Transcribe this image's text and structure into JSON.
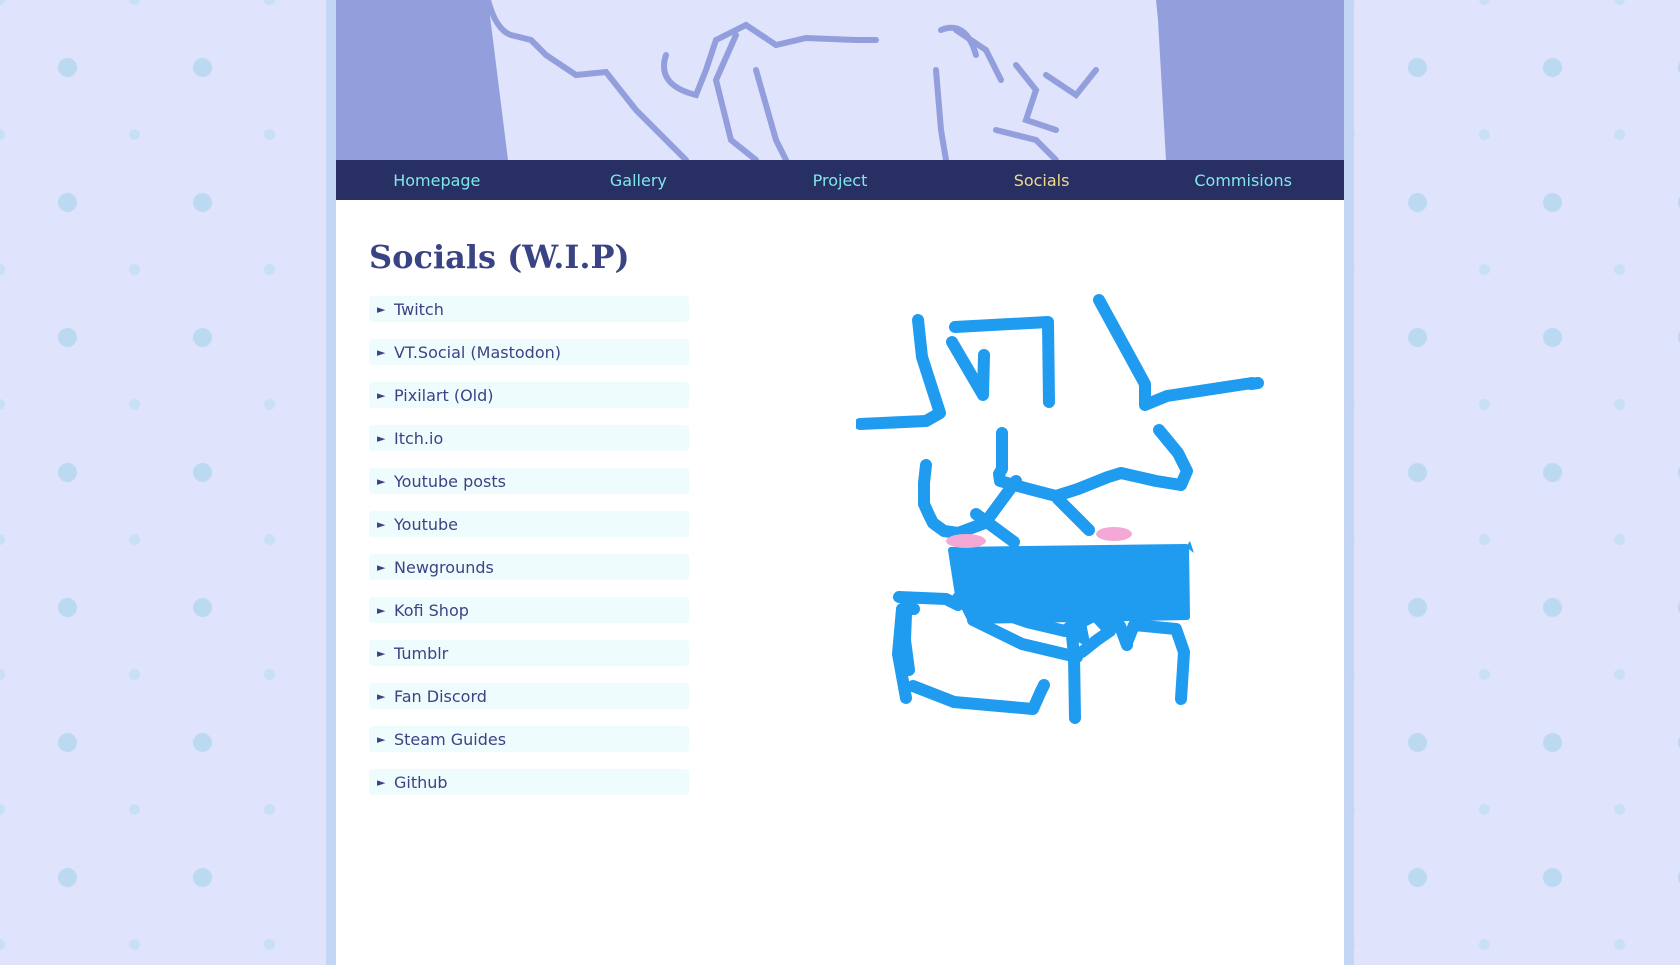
{
  "nav": {
    "items": [
      {
        "label": "Homepage"
      },
      {
        "label": "Gallery"
      },
      {
        "label": "Project"
      },
      {
        "label": "Socials",
        "active": true
      },
      {
        "label": "Commisions"
      }
    ]
  },
  "page": {
    "title": "Socials (W.I.P)"
  },
  "socials": {
    "items": [
      {
        "label": "Twitch"
      },
      {
        "label": "VT.Social (Mastodon)"
      },
      {
        "label": "Pixilart (Old)"
      },
      {
        "label": "Itch.io"
      },
      {
        "label": "Youtube posts"
      },
      {
        "label": "Youtube"
      },
      {
        "label": "Newgrounds"
      },
      {
        "label": "Kofi Shop"
      },
      {
        "label": "Tumblr"
      },
      {
        "label": "Fan Discord"
      },
      {
        "label": "Steam Guides"
      },
      {
        "label": "Github"
      }
    ],
    "arrow_glyph": "►"
  },
  "colors": {
    "nav_bg": "#282f63",
    "nav_text": "#7fe7ea",
    "nav_active": "#f3d98b",
    "heading": "#3a4485",
    "item_bg": "#eefcfd",
    "drawing_stroke": "#1f9bef",
    "blush": "#f4a8d6"
  }
}
